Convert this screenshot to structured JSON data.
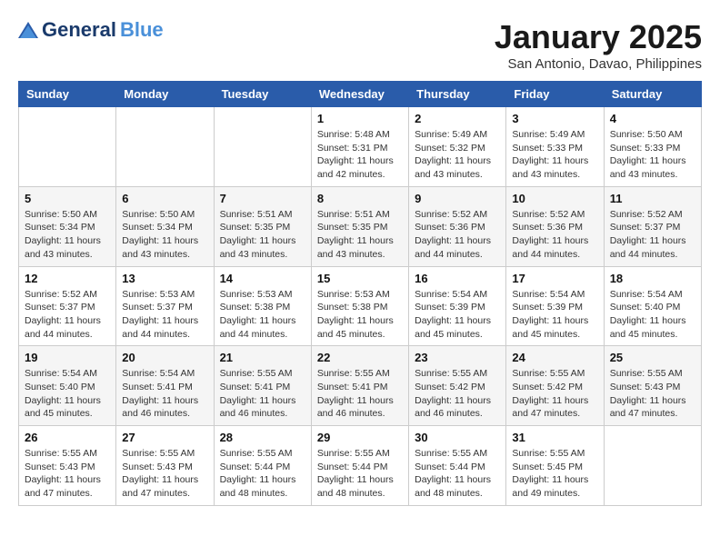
{
  "header": {
    "logo_general": "General",
    "logo_blue": "Blue",
    "title": "January 2025",
    "subtitle": "San Antonio, Davao, Philippines"
  },
  "calendar": {
    "days_of_week": [
      "Sunday",
      "Monday",
      "Tuesday",
      "Wednesday",
      "Thursday",
      "Friday",
      "Saturday"
    ],
    "weeks": [
      [
        {
          "day": "",
          "info": ""
        },
        {
          "day": "",
          "info": ""
        },
        {
          "day": "",
          "info": ""
        },
        {
          "day": "1",
          "info": "Sunrise: 5:48 AM\nSunset: 5:31 PM\nDaylight: 11 hours\nand 42 minutes."
        },
        {
          "day": "2",
          "info": "Sunrise: 5:49 AM\nSunset: 5:32 PM\nDaylight: 11 hours\nand 43 minutes."
        },
        {
          "day": "3",
          "info": "Sunrise: 5:49 AM\nSunset: 5:33 PM\nDaylight: 11 hours\nand 43 minutes."
        },
        {
          "day": "4",
          "info": "Sunrise: 5:50 AM\nSunset: 5:33 PM\nDaylight: 11 hours\nand 43 minutes."
        }
      ],
      [
        {
          "day": "5",
          "info": "Sunrise: 5:50 AM\nSunset: 5:34 PM\nDaylight: 11 hours\nand 43 minutes."
        },
        {
          "day": "6",
          "info": "Sunrise: 5:50 AM\nSunset: 5:34 PM\nDaylight: 11 hours\nand 43 minutes."
        },
        {
          "day": "7",
          "info": "Sunrise: 5:51 AM\nSunset: 5:35 PM\nDaylight: 11 hours\nand 43 minutes."
        },
        {
          "day": "8",
          "info": "Sunrise: 5:51 AM\nSunset: 5:35 PM\nDaylight: 11 hours\nand 43 minutes."
        },
        {
          "day": "9",
          "info": "Sunrise: 5:52 AM\nSunset: 5:36 PM\nDaylight: 11 hours\nand 44 minutes."
        },
        {
          "day": "10",
          "info": "Sunrise: 5:52 AM\nSunset: 5:36 PM\nDaylight: 11 hours\nand 44 minutes."
        },
        {
          "day": "11",
          "info": "Sunrise: 5:52 AM\nSunset: 5:37 PM\nDaylight: 11 hours\nand 44 minutes."
        }
      ],
      [
        {
          "day": "12",
          "info": "Sunrise: 5:52 AM\nSunset: 5:37 PM\nDaylight: 11 hours\nand 44 minutes."
        },
        {
          "day": "13",
          "info": "Sunrise: 5:53 AM\nSunset: 5:37 PM\nDaylight: 11 hours\nand 44 minutes."
        },
        {
          "day": "14",
          "info": "Sunrise: 5:53 AM\nSunset: 5:38 PM\nDaylight: 11 hours\nand 44 minutes."
        },
        {
          "day": "15",
          "info": "Sunrise: 5:53 AM\nSunset: 5:38 PM\nDaylight: 11 hours\nand 45 minutes."
        },
        {
          "day": "16",
          "info": "Sunrise: 5:54 AM\nSunset: 5:39 PM\nDaylight: 11 hours\nand 45 minutes."
        },
        {
          "day": "17",
          "info": "Sunrise: 5:54 AM\nSunset: 5:39 PM\nDaylight: 11 hours\nand 45 minutes."
        },
        {
          "day": "18",
          "info": "Sunrise: 5:54 AM\nSunset: 5:40 PM\nDaylight: 11 hours\nand 45 minutes."
        }
      ],
      [
        {
          "day": "19",
          "info": "Sunrise: 5:54 AM\nSunset: 5:40 PM\nDaylight: 11 hours\nand 45 minutes."
        },
        {
          "day": "20",
          "info": "Sunrise: 5:54 AM\nSunset: 5:41 PM\nDaylight: 11 hours\nand 46 minutes."
        },
        {
          "day": "21",
          "info": "Sunrise: 5:55 AM\nSunset: 5:41 PM\nDaylight: 11 hours\nand 46 minutes."
        },
        {
          "day": "22",
          "info": "Sunrise: 5:55 AM\nSunset: 5:41 PM\nDaylight: 11 hours\nand 46 minutes."
        },
        {
          "day": "23",
          "info": "Sunrise: 5:55 AM\nSunset: 5:42 PM\nDaylight: 11 hours\nand 46 minutes."
        },
        {
          "day": "24",
          "info": "Sunrise: 5:55 AM\nSunset: 5:42 PM\nDaylight: 11 hours\nand 47 minutes."
        },
        {
          "day": "25",
          "info": "Sunrise: 5:55 AM\nSunset: 5:43 PM\nDaylight: 11 hours\nand 47 minutes."
        }
      ],
      [
        {
          "day": "26",
          "info": "Sunrise: 5:55 AM\nSunset: 5:43 PM\nDaylight: 11 hours\nand 47 minutes."
        },
        {
          "day": "27",
          "info": "Sunrise: 5:55 AM\nSunset: 5:43 PM\nDaylight: 11 hours\nand 47 minutes."
        },
        {
          "day": "28",
          "info": "Sunrise: 5:55 AM\nSunset: 5:44 PM\nDaylight: 11 hours\nand 48 minutes."
        },
        {
          "day": "29",
          "info": "Sunrise: 5:55 AM\nSunset: 5:44 PM\nDaylight: 11 hours\nand 48 minutes."
        },
        {
          "day": "30",
          "info": "Sunrise: 5:55 AM\nSunset: 5:44 PM\nDaylight: 11 hours\nand 48 minutes."
        },
        {
          "day": "31",
          "info": "Sunrise: 5:55 AM\nSunset: 5:45 PM\nDaylight: 11 hours\nand 49 minutes."
        },
        {
          "day": "",
          "info": ""
        }
      ]
    ]
  }
}
